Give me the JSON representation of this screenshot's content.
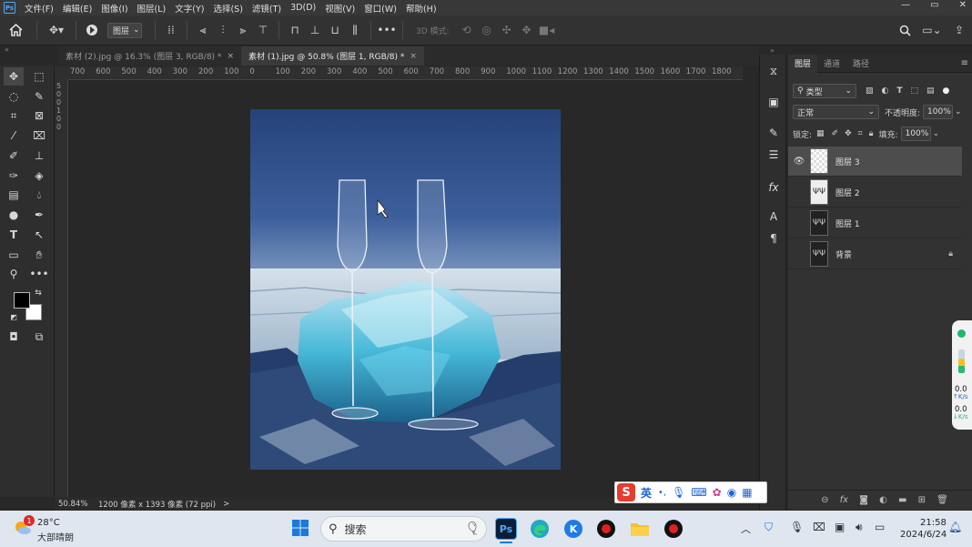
{
  "menubar": {
    "logo": "Ps",
    "items": [
      "文件(F)",
      "编辑(E)",
      "图像(I)",
      "图层(L)",
      "文字(Y)",
      "选择(S)",
      "滤镜(T)",
      "3D(D)",
      "视图(V)",
      "窗口(W)",
      "帮助(H)"
    ],
    "window_controls": [
      "—",
      "▭",
      "✕"
    ]
  },
  "options": {
    "layer_select": "图层",
    "mode3d": "3D 模式:"
  },
  "tabs": [
    {
      "label": "素材 (2).jpg @ 16.3% (图层 3, RGB/8) *",
      "close": "×"
    },
    {
      "label": "素材 (1).jpg @ 50.8% (图层 1, RGB/8) *",
      "close": "×"
    }
  ],
  "ruler_top": [
    "700",
    "600",
    "500",
    "400",
    "300",
    "200",
    "100",
    "0",
    "100",
    "200",
    "300",
    "400",
    "500",
    "600",
    "700",
    "800",
    "900",
    "1000",
    "1100",
    "1200",
    "1300",
    "1400",
    "1500",
    "1600",
    "1700",
    "1800"
  ],
  "ruler_left": [
    "5",
    "0",
    "0",
    "1",
    "0",
    "0"
  ],
  "status": {
    "zoom": "50.84%",
    "doc_info": "1200 像素 x 1393 像素 (72 ppi)",
    "arrow": ">"
  },
  "layers_panel": {
    "tabs": [
      "图层",
      "通道",
      "路径"
    ],
    "filter_label": "类型",
    "blend_mode": "正常",
    "opacity_label": "不透明度:",
    "opacity_value": "100%",
    "lock_label": "锁定:",
    "fill_label": "填充:",
    "fill_value": "100%",
    "layers": [
      {
        "name": "图层 3",
        "visible": true,
        "selected": true
      },
      {
        "name": "图层 2",
        "visible": false,
        "selected": false
      },
      {
        "name": "图层 1",
        "visible": false,
        "selected": false
      },
      {
        "name": "背景",
        "visible": false,
        "selected": false,
        "locked": true
      }
    ],
    "bottom_icons": [
      "link-icon",
      "fx-icon",
      "mask-icon",
      "adjustment-icon",
      "folder-icon",
      "new-layer-icon",
      "trash-icon"
    ]
  },
  "ime": {
    "lang": "英"
  },
  "network_widget": {
    "up_value": "0.0",
    "up_unit": "K/s",
    "down_value": "0.0",
    "down_unit": "K/s"
  },
  "taskbar": {
    "weather_badge": "1",
    "temp": "28°C",
    "weather": "大部晴朗",
    "search_placeholder": "搜索",
    "ps_label": "Ps",
    "k_label": "K",
    "time": "21:58",
    "date": "2024/6/24"
  },
  "colors": {
    "accent": "#4aa8ff",
    "panel_bg": "#323232",
    "selected_layer": "#4d4d4d",
    "taskbar_bg": "#dfe6f0"
  }
}
